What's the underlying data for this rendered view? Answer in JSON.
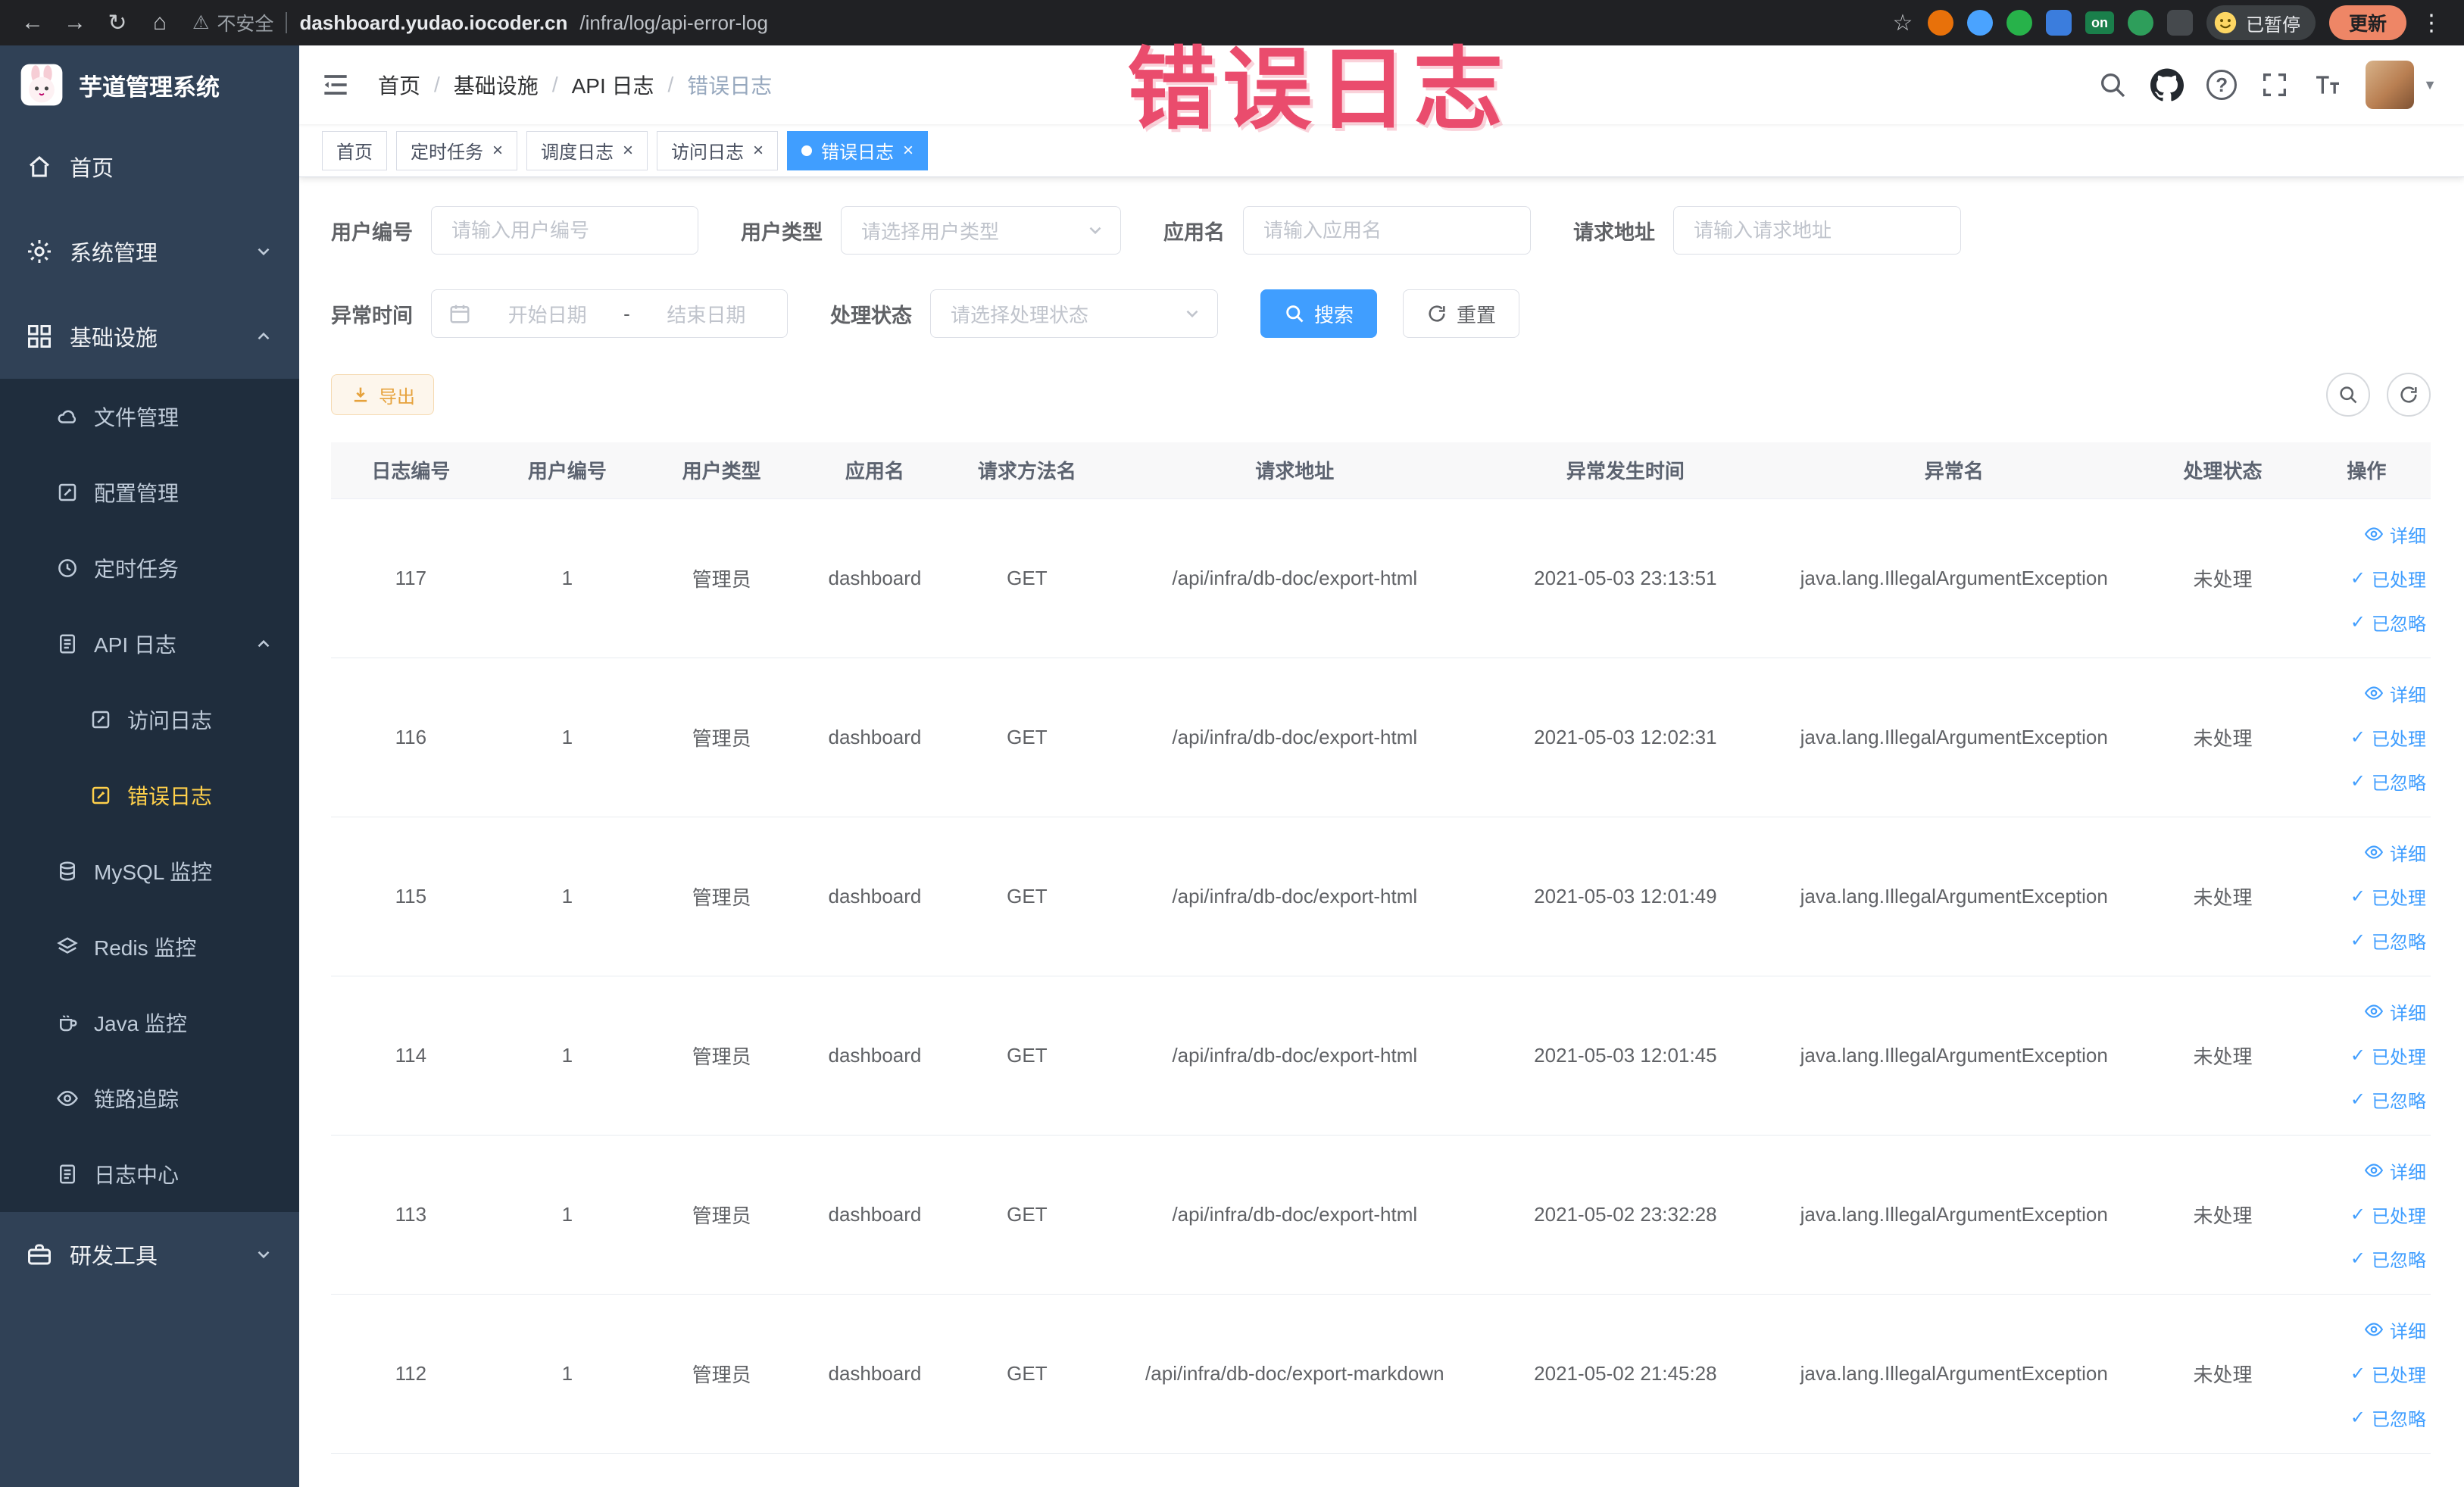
{
  "annotation": {
    "text": "错误日志"
  },
  "glyphs": {
    "back": "←",
    "forward": "→",
    "reload": "↻",
    "home": "⌂",
    "warning": "⚠",
    "star": "☆",
    "more": "⋮",
    "close": "×",
    "check": "✓",
    "caret_down": "▼",
    "question": "?"
  },
  "browser": {
    "security_label": "不安全",
    "url_domain": "dashboard.yudao.iocoder.cn",
    "url_path": "/infra/log/api-error-log",
    "ext_on_label": "on",
    "paused_label": "已暂停",
    "update_label": "更新"
  },
  "sidebar": {
    "logo_title": "芋道管理系统",
    "items": {
      "home": "首页",
      "system": "系统管理",
      "infra": "基础设施",
      "file": "文件管理",
      "config": "配置管理",
      "job": "定时任务",
      "api_log": "API 日志",
      "access_log": "访问日志",
      "error_log": "错误日志",
      "mysql": "MySQL 监控",
      "redis": "Redis 监控",
      "java": "Java 监控",
      "trace": "链路追踪",
      "log_center": "日志中心",
      "dev_tools": "研发工具"
    }
  },
  "breadcrumb": {
    "items": [
      "首页",
      "基础设施",
      "API 日志",
      "错误日志"
    ],
    "separator": "/"
  },
  "tabs": [
    {
      "label": "首页"
    },
    {
      "label": "定时任务"
    },
    {
      "label": "调度日志"
    },
    {
      "label": "访问日志"
    },
    {
      "label": "错误日志"
    }
  ],
  "filters": {
    "user_id_label": "用户编号",
    "user_id_placeholder": "请输入用户编号",
    "user_type_label": "用户类型",
    "user_type_placeholder": "请选择用户类型",
    "app_name_label": "应用名",
    "app_name_placeholder": "请输入应用名",
    "request_url_label": "请求地址",
    "request_url_placeholder": "请输入请求地址",
    "exception_time_label": "异常时间",
    "date_start_placeholder": "开始日期",
    "date_separator": "-",
    "date_end_placeholder": "结束日期",
    "process_status_label": "处理状态",
    "process_status_placeholder": "请选择处理状态",
    "search_label": "搜索",
    "reset_label": "重置"
  },
  "toolbar": {
    "export_label": "导出"
  },
  "table": {
    "columns": [
      "日志编号",
      "用户编号",
      "用户类型",
      "应用名",
      "请求方法名",
      "请求地址",
      "异常发生时间",
      "异常名",
      "处理状态",
      "操作"
    ],
    "action_detail": "详细",
    "action_processed": "已处理",
    "action_ignored": "已忽略",
    "rows": [
      {
        "id": "117",
        "user_id": "1",
        "user_type": "管理员",
        "app_name": "dashboard",
        "method": "GET",
        "url": "/api/infra/db-doc/export-html",
        "time": "2021-05-03 23:13:51",
        "exception": "java.lang.IllegalArgumentException",
        "status": "未处理"
      },
      {
        "id": "116",
        "user_id": "1",
        "user_type": "管理员",
        "app_name": "dashboard",
        "method": "GET",
        "url": "/api/infra/db-doc/export-html",
        "time": "2021-05-03 12:02:31",
        "exception": "java.lang.IllegalArgumentException",
        "status": "未处理"
      },
      {
        "id": "115",
        "user_id": "1",
        "user_type": "管理员",
        "app_name": "dashboard",
        "method": "GET",
        "url": "/api/infra/db-doc/export-html",
        "time": "2021-05-03 12:01:49",
        "exception": "java.lang.IllegalArgumentException",
        "status": "未处理"
      },
      {
        "id": "114",
        "user_id": "1",
        "user_type": "管理员",
        "app_name": "dashboard",
        "method": "GET",
        "url": "/api/infra/db-doc/export-html",
        "time": "2021-05-03 12:01:45",
        "exception": "java.lang.IllegalArgumentException",
        "status": "未处理"
      },
      {
        "id": "113",
        "user_id": "1",
        "user_type": "管理员",
        "app_name": "dashboard",
        "method": "GET",
        "url": "/api/infra/db-doc/export-html",
        "time": "2021-05-02 23:32:28",
        "exception": "java.lang.IllegalArgumentException",
        "status": "未处理"
      },
      {
        "id": "112",
        "user_id": "1",
        "user_type": "管理员",
        "app_name": "dashboard",
        "method": "GET",
        "url": "/api/infra/db-doc/export-markdown",
        "time": "2021-05-02 21:45:28",
        "exception": "java.lang.IllegalArgumentException",
        "status": "未处理"
      }
    ]
  }
}
